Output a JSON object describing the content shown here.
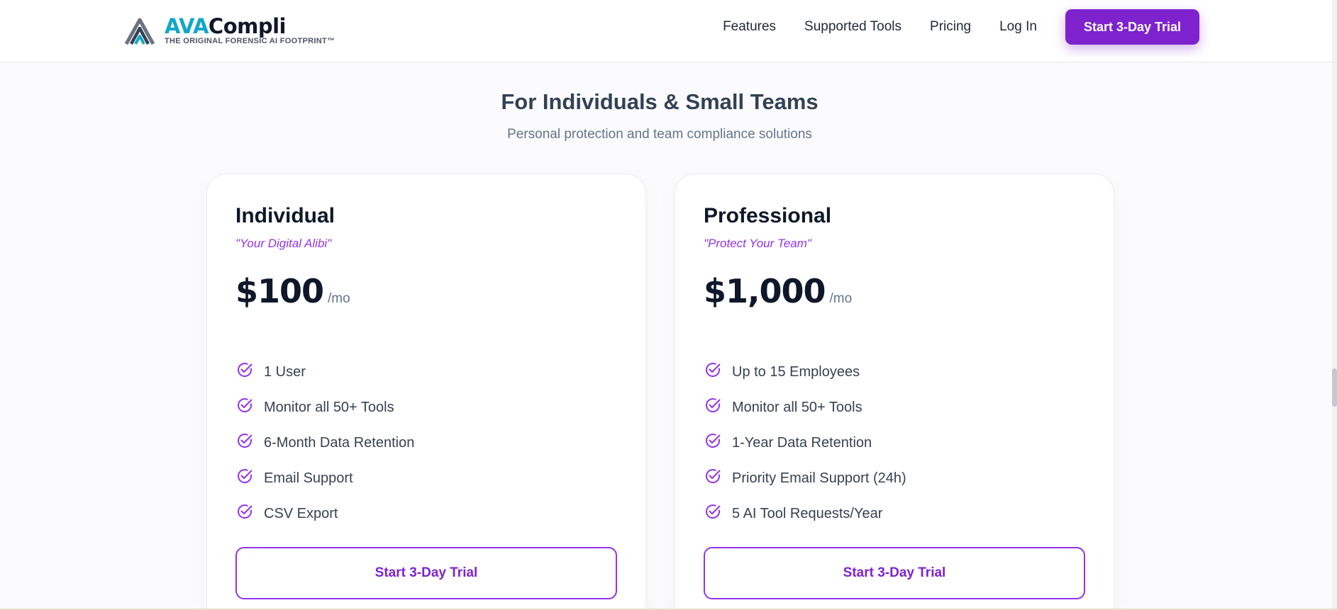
{
  "header": {
    "brand": {
      "name_part1": "AVA",
      "name_part2": "Compli",
      "tagline": "THE ORIGINAL FORENSIC AI FOOTPRINT™",
      "logo_icon": "stacked-chevron-logo"
    },
    "nav": [
      "Features",
      "Supported Tools",
      "Pricing",
      "Log In"
    ],
    "cta": "Start 3-Day Trial"
  },
  "section": {
    "title": "For Individuals & Small Teams",
    "subtitle": "Personal protection and team compliance solutions"
  },
  "plans": [
    {
      "name": "Individual",
      "motto": "\"Your Digital Alibi\"",
      "price": "$100",
      "period": "/mo",
      "features": [
        "1 User",
        "Monitor all 50+ Tools",
        "6-Month Data Retention",
        "Email Support",
        "CSV Export"
      ],
      "button": "Start 3-Day Trial"
    },
    {
      "name": "Professional",
      "motto": "\"Protect Your Team\"",
      "price": "$1,000",
      "period": "/mo",
      "features": [
        "Up to 15 Employees",
        "Monitor all 50+ Tools",
        "1-Year Data Retention",
        "Priority Email Support (24h)",
        "5 AI Tool Requests/Year"
      ],
      "button": "Start 3-Day Trial"
    }
  ],
  "icons": {
    "feature_check": "check-circle-icon"
  },
  "colors": {
    "accent": "#7e22ce",
    "accent_light": "#9333ea",
    "brand_cyan": "#13a7c7",
    "heading": "#334155"
  }
}
